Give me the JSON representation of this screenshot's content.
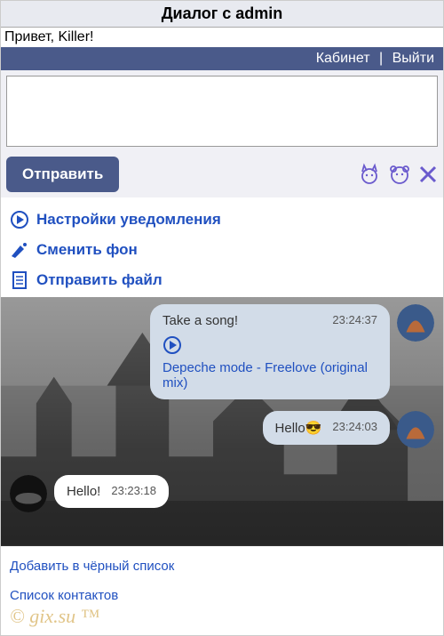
{
  "title": "Диалог с admin",
  "greeting": "Привет, Killer!",
  "nav": {
    "cabinet": "Кабинет",
    "logout": "Выйти",
    "sep": "|"
  },
  "compose": {
    "send": "Отправить"
  },
  "actions": {
    "notify": "Настройки уведомления",
    "bg": "Сменить фон",
    "file": "Отправить файл"
  },
  "messages": [
    {
      "side": "right",
      "text": "Take a song!",
      "time": "23:24:37",
      "song": "Depeche mode - Freelove (original mix)",
      "avatar_color": "#b86a3a"
    },
    {
      "side": "right",
      "text": "Hello😎",
      "time": "23:24:03",
      "avatar_color": "#b86a3a"
    },
    {
      "side": "left",
      "text": "Hello!",
      "time": "23:23:18",
      "avatar_color": "#222"
    }
  ],
  "footer": {
    "blacklist": "Добавить в чёрный список",
    "contacts": "Список контактов"
  },
  "watermark": "© gix.su ™"
}
